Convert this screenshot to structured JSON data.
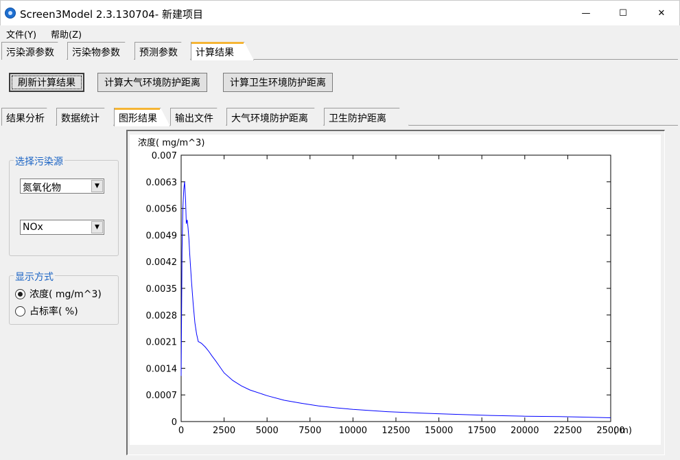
{
  "window": {
    "title": "Screen3Model 2.3.130704- 新建项目",
    "minimize_glyph": "—",
    "maximize_glyph": "☐",
    "close_glyph": "✕"
  },
  "menu": [
    "文件(Y)",
    "帮助(Z)"
  ],
  "top_tabs": [
    "污染源参数",
    "污染物参数",
    "预测参数",
    "计算结果"
  ],
  "active_top_tab": "计算结果",
  "action_buttons": [
    "刷新计算结果",
    "计算大气环境防护距离",
    "计算卫生环境防护距离"
  ],
  "sub_tabs": [
    "结果分析",
    "数据统计",
    "图形结果",
    "输出文件",
    "大气环境防护距离",
    "卫生防护距离"
  ],
  "active_sub_tab": "图形结果",
  "source_group": {
    "title": "选择污染源",
    "source_value": "氮氧化物",
    "pollutant_value": "NOx"
  },
  "display_group": {
    "title": "显示方式",
    "options": [
      "浓度( mg/m^3)",
      "占标率( %)"
    ],
    "selected": 0
  },
  "colors": {
    "accent": "#f5b534",
    "line": "#0000ff",
    "group_title": "#1a63c4"
  },
  "chart_data": {
    "type": "line",
    "ylabel": "浓度( mg/m^3)",
    "x_unit_label": "( m)",
    "x_ticks": [
      "0",
      "2500",
      "5000",
      "7500",
      "10000",
      "12500",
      "15000",
      "17500",
      "20000",
      "22500",
      "25000"
    ],
    "y_ticks": [
      "0",
      "0.0007",
      "0.0014",
      "0.0021",
      "0.0028",
      "0.0035",
      "0.0042",
      "0.0049",
      "0.0056",
      "0.0063",
      "0.007"
    ],
    "xlim": [
      0,
      25000
    ],
    "ylim": [
      0,
      0.007
    ],
    "series": [
      {
        "x": [
          0,
          50,
          100,
          150,
          200,
          260,
          300,
          350,
          400,
          450,
          500,
          600,
          700,
          800,
          900,
          1000,
          1100,
          1200,
          1400,
          1600,
          1800,
          2000,
          2500,
          3000,
          3500,
          4000,
          5000,
          6000,
          7000,
          8000,
          9000,
          10000,
          12000,
          14000,
          16000,
          18000,
          20000,
          22000,
          24000,
          25000
        ],
        "y": [
          0.0012,
          0.0045,
          0.0056,
          0.0061,
          0.0063,
          0.0058,
          0.0052,
          0.0053,
          0.0051,
          0.0048,
          0.0044,
          0.0037,
          0.0031,
          0.0026,
          0.0023,
          0.0021,
          0.00208,
          0.00205,
          0.00196,
          0.00185,
          0.00172,
          0.0016,
          0.00128,
          0.00108,
          0.00094,
          0.00083,
          0.00068,
          0.00056,
          0.00048,
          0.00041,
          0.00036,
          0.00032,
          0.00026,
          0.00022,
          0.00019,
          0.00016,
          0.00014,
          0.00013,
          0.00011,
          0.0001
        ]
      }
    ]
  }
}
